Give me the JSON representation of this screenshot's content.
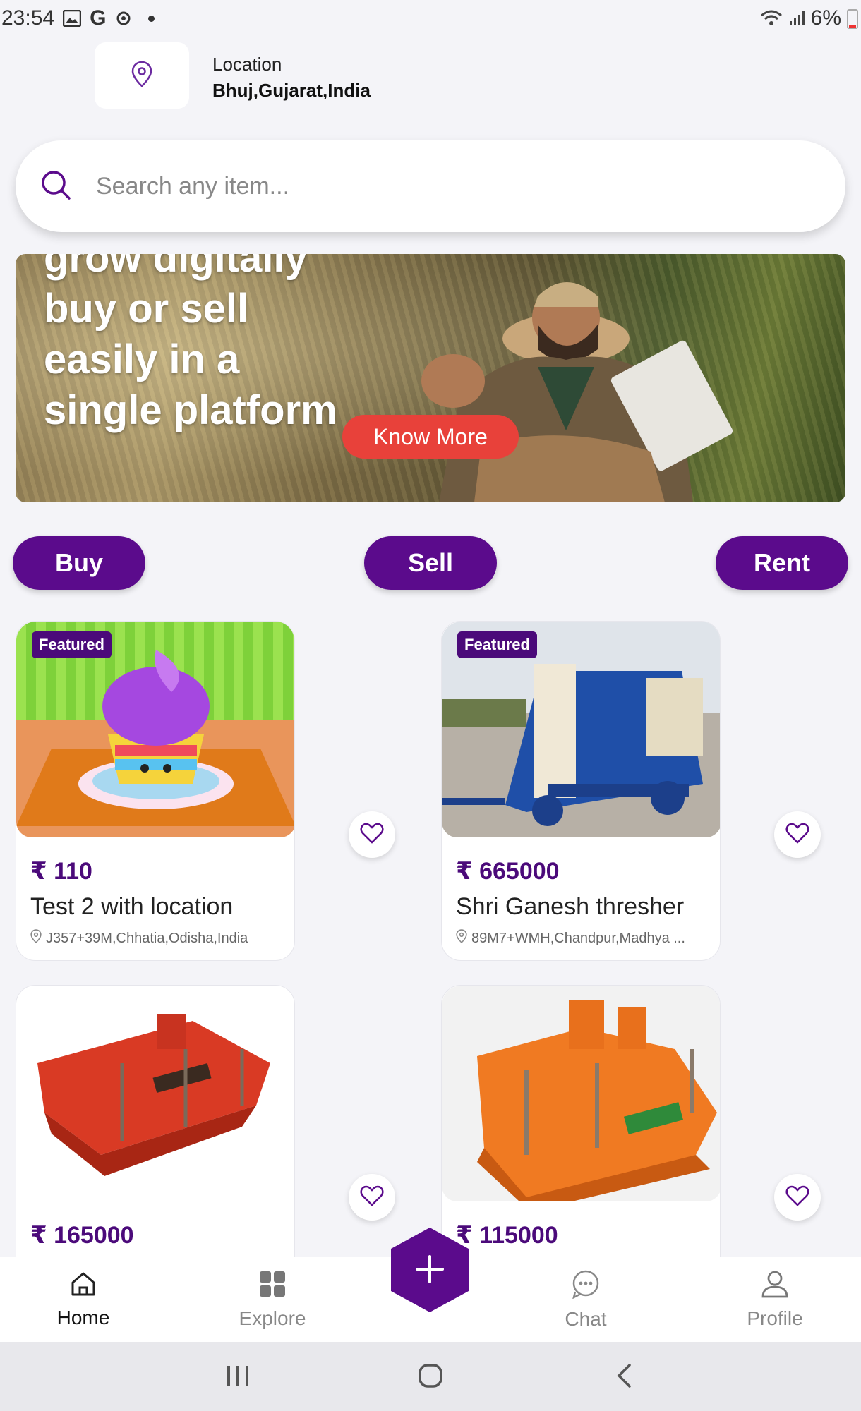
{
  "status_bar": {
    "time": "23:54",
    "g_letter": "G",
    "battery": "6%"
  },
  "location": {
    "label": "Location",
    "value": "Bhuj,Gujarat,India"
  },
  "search": {
    "placeholder": "Search any item..."
  },
  "banner": {
    "title_lines": "grow digitally\nbuy or sell\neasily  in a\nsingle platform",
    "cta_label": "Know More"
  },
  "actions": {
    "buy": "Buy",
    "sell": "Sell",
    "rent": "Rent"
  },
  "products": [
    {
      "badge": "Featured",
      "price": "₹ 110",
      "title": "Test 2 with location",
      "location": "J357+39M,Chhatia,Odisha,India",
      "image": "cupcake-image"
    },
    {
      "badge": "Featured",
      "price": "₹ 665000",
      "title": "Shri Ganesh thresher",
      "location": "89M7+WMH,Chandpur,Madhya ...",
      "image": "thresher-image"
    },
    {
      "price": "₹ 165000",
      "image": "rotavator-red-image"
    },
    {
      "price": "₹ 115000",
      "image": "rotavator-orange-image"
    }
  ],
  "bottom_nav": {
    "home": "Home",
    "explore": "Explore",
    "chat": "Chat",
    "profile": "Profile"
  },
  "colors": {
    "accent": "#5b0b8c",
    "cta": "#e8413a",
    "background": "#f4f4f8"
  }
}
